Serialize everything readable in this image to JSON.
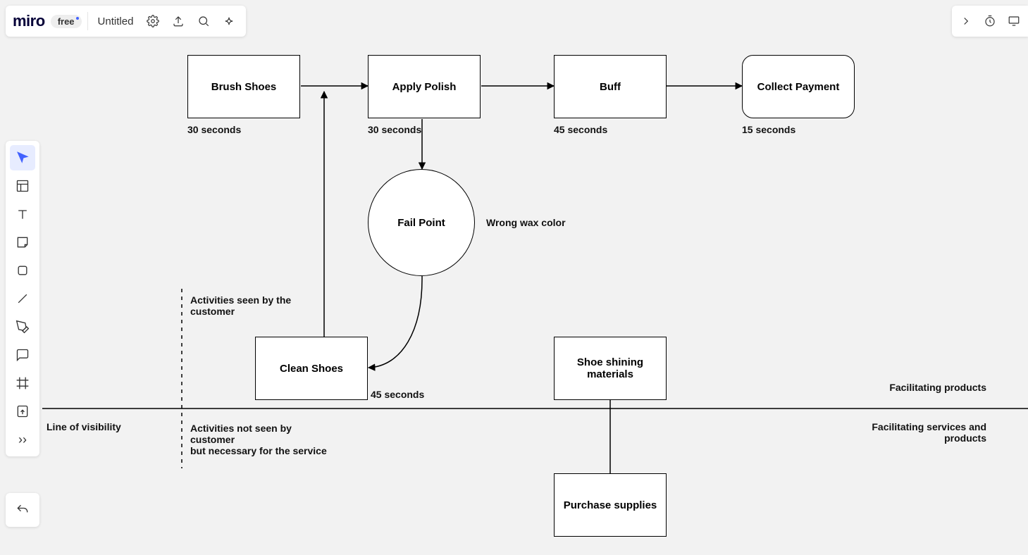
{
  "app": {
    "logo": "miro",
    "plan": "free",
    "doc_title": "Untitled"
  },
  "diagram": {
    "nodes": {
      "brush": "Brush Shoes",
      "polish": "Apply Polish",
      "buff": "Buff",
      "collect": "Collect Payment",
      "fail": "Fail Point",
      "clean": "Clean Shoes",
      "materials": "Shoe shining materials",
      "purchase": "Purchase supplies"
    },
    "captions": {
      "brush_time": "30 seconds",
      "polish_time": "30 seconds",
      "buff_time": "45 seconds",
      "collect_time": "15 seconds",
      "clean_time": "45 seconds",
      "fail_note": "Wrong wax color"
    },
    "labels": {
      "seen": "Activities seen by the customer",
      "notseen": "Activities not seen by customer\nbut necessary for the service",
      "visibility": "Line of visibility",
      "fac_products": "Facilitating products",
      "fac_services": "Facilitating services and products"
    }
  }
}
